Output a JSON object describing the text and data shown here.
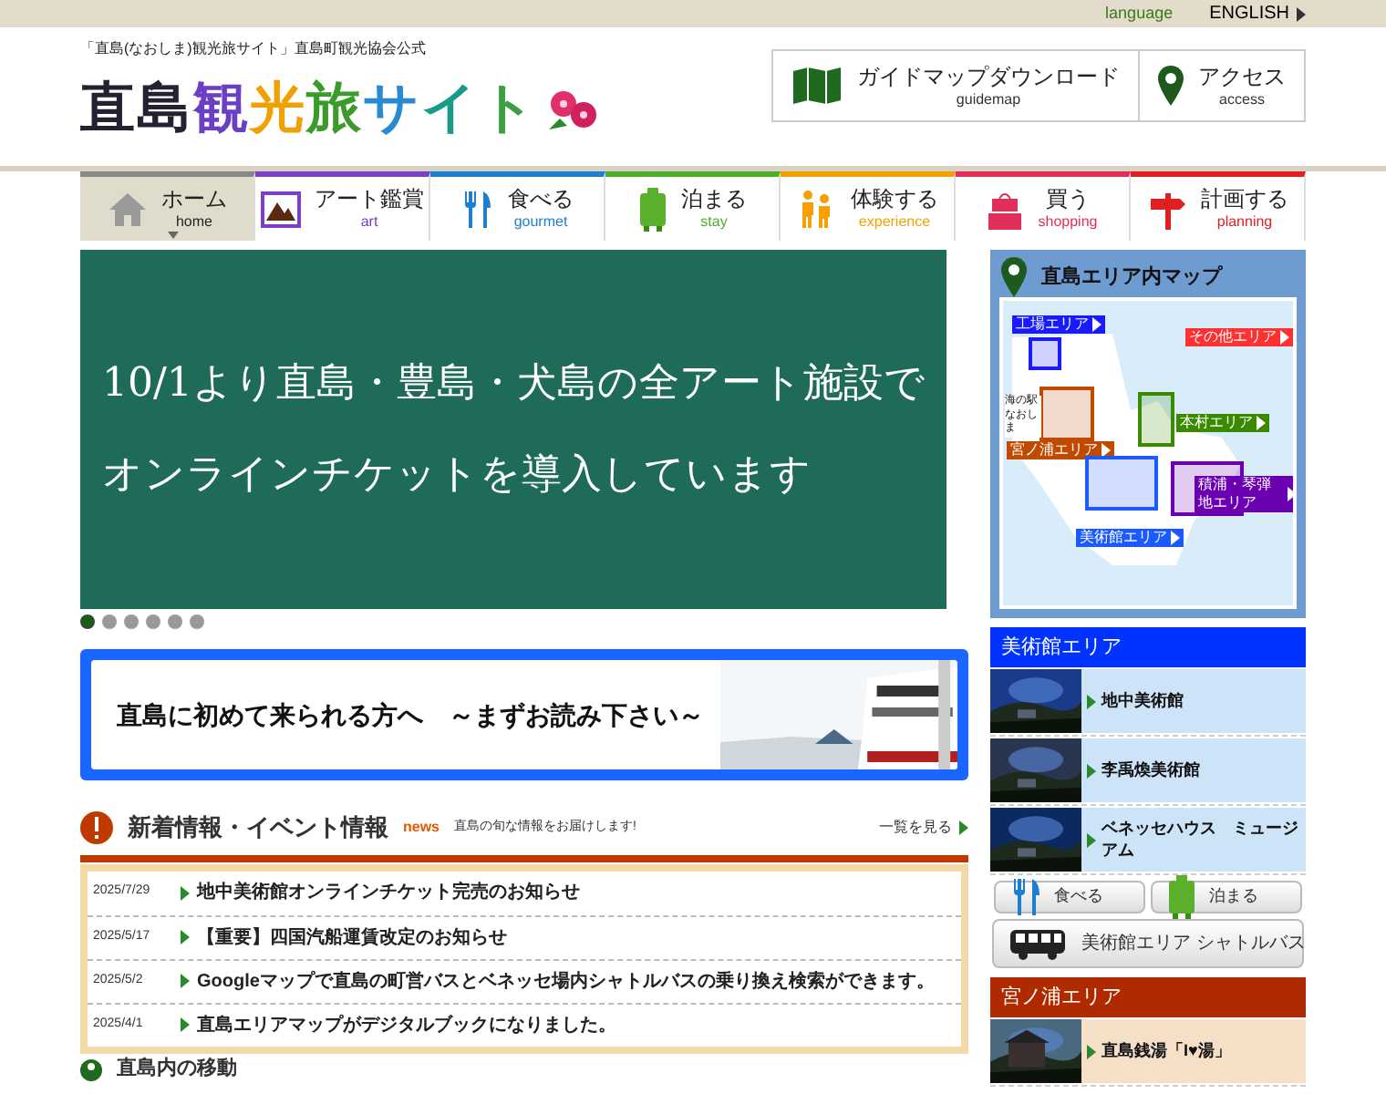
{
  "top_bar": {
    "language_label": "language",
    "english_link": "ENGLISH"
  },
  "header": {
    "tagline": "「直島(なおしま)観光旅サイト」直島町観光協会公式",
    "logo_text": "直島観光旅サイト",
    "links": [
      {
        "kind": "map",
        "label": "ガイドマップダウンロード",
        "sublabel": "guidemap"
      },
      {
        "kind": "pin",
        "label": "アクセス",
        "sublabel": "access"
      }
    ]
  },
  "nav": [
    {
      "kind": "home",
      "label": "ホーム",
      "sublabel": "home",
      "selected": true,
      "color": "#888888"
    },
    {
      "kind": "art",
      "label": "アート鑑賞",
      "sublabel": "art",
      "selected": false,
      "color": "#7b3fc4"
    },
    {
      "kind": "gourmet",
      "label": "食べる",
      "sublabel": "gourmet",
      "selected": false,
      "color": "#1e7fd1"
    },
    {
      "kind": "stay",
      "label": "泊まる",
      "sublabel": "stay",
      "selected": false,
      "color": "#4caf2a"
    },
    {
      "kind": "experience",
      "label": "体験する",
      "sublabel": "experience",
      "selected": false,
      "color": "#f5a000"
    },
    {
      "kind": "shopping",
      "label": "買う",
      "sublabel": "shopping",
      "selected": false,
      "color": "#e0305a"
    },
    {
      "kind": "planning",
      "label": "計画する",
      "sublabel": "planning",
      "selected": false,
      "color": "#e02020"
    }
  ],
  "hero": {
    "lines": [
      "10/1より直島・豊島・犬島の全アート施設で",
      "オンラインチケットを導入しています"
    ]
  },
  "slide_dots": [
    {
      "selected": true
    },
    {
      "selected": false
    },
    {
      "selected": false
    },
    {
      "selected": false
    },
    {
      "selected": false
    },
    {
      "selected": false
    }
  ],
  "banner": {
    "text": "直島に初めて来られる方へ　～まずお読み下さい～"
  },
  "news": {
    "title": "新着情報・イベント情報",
    "tag": "news",
    "subtitle": "直島の旬な情報をお届けします!",
    "more_link": "一覧を見る",
    "items": [
      {
        "date": "2025/7/29",
        "title": "地中美術館オンラインチケット完売のお知らせ"
      },
      {
        "date": "2025/5/17",
        "title": "【重要】四国汽船運賃改定のお知らせ"
      },
      {
        "date": "2025/5/2",
        "title": "Googleマップで直島の町営バスとベネッセ場内シャトルバスの乗り換え検索ができます。"
      },
      {
        "date": "2025/4/1",
        "title": "直島エリアマップがデジタルブックになりました。"
      }
    ]
  },
  "next_heading": "直島内の移動",
  "map": {
    "title": "直島エリア内マップ",
    "port_label": "海の駅なおしま",
    "areas": [
      {
        "label": "工場エリア",
        "color": "#1a1aff"
      },
      {
        "label": "その他エリア",
        "color": "#ff3030"
      },
      {
        "label": "本村エリア",
        "color": "#3a8a00"
      },
      {
        "label": "宮ノ浦エリア",
        "color": "#c04a00"
      },
      {
        "label": "積浦・琴弾地エリア",
        "color": "#6a00b0"
      },
      {
        "label": "美術館エリア",
        "color": "#1a5aff"
      }
    ]
  },
  "area_sections": [
    {
      "title": "美術館エリア",
      "color": "#0033ff",
      "spots": [
        {
          "name": "地中美術館"
        },
        {
          "name": "李禹煥美術館"
        },
        {
          "name": "ベネッセハウス　ミュージアム"
        }
      ],
      "buttons": [
        {
          "kind": "gourmet",
          "label": "食べる"
        },
        {
          "kind": "stay",
          "label": "泊まる"
        },
        {
          "kind": "bus",
          "label": "美術館エリア シャトルバス"
        }
      ]
    },
    {
      "title": "宮ノ浦エリア",
      "color": "#b02a00",
      "spots": [
        {
          "name": "直島銭湯「I♥湯」"
        }
      ]
    }
  ]
}
